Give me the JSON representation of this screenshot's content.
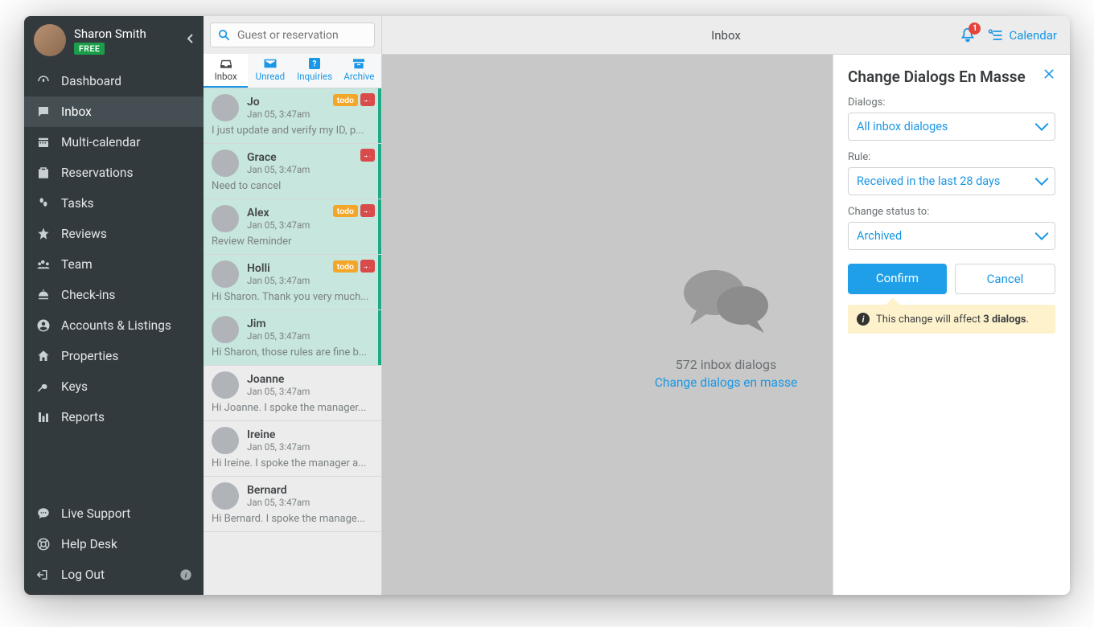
{
  "user": {
    "name": "Sharon Smith",
    "plan": "FREE"
  },
  "nav": {
    "items": [
      {
        "id": "dashboard",
        "label": "Dashboard"
      },
      {
        "id": "inbox",
        "label": "Inbox"
      },
      {
        "id": "multi-calendar",
        "label": "Multi-calendar"
      },
      {
        "id": "reservations",
        "label": "Reservations"
      },
      {
        "id": "tasks",
        "label": "Tasks"
      },
      {
        "id": "reviews",
        "label": "Reviews"
      },
      {
        "id": "team",
        "label": "Team"
      },
      {
        "id": "check-ins",
        "label": "Check-ins"
      },
      {
        "id": "accounts",
        "label": "Accounts & Listings"
      },
      {
        "id": "properties",
        "label": "Properties"
      },
      {
        "id": "keys",
        "label": "Keys"
      },
      {
        "id": "reports",
        "label": "Reports"
      }
    ],
    "bottom": [
      {
        "id": "live-support",
        "label": "Live Support"
      },
      {
        "id": "help-desk",
        "label": "Help Desk"
      },
      {
        "id": "log-out",
        "label": "Log Out"
      }
    ],
    "active": "inbox"
  },
  "search": {
    "placeholder": "Guest or reservation"
  },
  "tabs": [
    {
      "id": "inbox",
      "label": "Inbox"
    },
    {
      "id": "unread",
      "label": "Unread"
    },
    {
      "id": "inquiries",
      "label": "Inquiries"
    },
    {
      "id": "archive",
      "label": "Archive"
    }
  ],
  "tabs_active": "inbox",
  "messages": [
    {
      "name": "Jo",
      "date": "Jan 05, 3:47am",
      "preview": "I just update and verify my ID, p...",
      "todo": "todo",
      "pin": true,
      "highlight": true
    },
    {
      "name": "Grace",
      "date": "Jan 05, 3:47am",
      "preview": "Need to cancel",
      "todo": "",
      "pin": true,
      "highlight": true
    },
    {
      "name": "Alex",
      "date": "Jan 05, 3:47am",
      "preview": "Review Reminder",
      "todo": "todo",
      "pin": true,
      "highlight": true
    },
    {
      "name": "Holli",
      "date": "Jan 05, 3:47am",
      "preview": "Hi Sharon. Thank you very much...",
      "todo": "todo",
      "pin": true,
      "highlight": true
    },
    {
      "name": "Jim",
      "date": "Jan 05, 3:47am",
      "preview": "Hi Sharon, those rules are fine b...",
      "todo": "",
      "pin": false,
      "highlight": true
    },
    {
      "name": "Joanne",
      "date": "Jan 05, 3:47am",
      "preview": "Hi Joanne. I spoke the manager...",
      "todo": "",
      "pin": false,
      "highlight": false
    },
    {
      "name": "Ireine",
      "date": "Jan 05, 3:47am",
      "preview": "Hi Ireine. I spoke the manager a...",
      "todo": "",
      "pin": false,
      "highlight": false
    },
    {
      "name": "Bernard",
      "date": "Jan 05, 3:47am",
      "preview": "Hi Bernard. I spoke the manage...",
      "todo": "",
      "pin": false,
      "highlight": false
    }
  ],
  "topbar": {
    "title": "Inbox",
    "notif_count": "1",
    "calendar_label": "Calendar"
  },
  "empty": {
    "count_text": "572 inbox dialogs",
    "link_text": "Change dialogs en masse"
  },
  "panel": {
    "title": "Change Dialogs En Masse",
    "dialogs_label": "Dialogs:",
    "dialogs_value": "All inbox dialoges",
    "rule_label": "Rule:",
    "rule_value": "Received in the last 28 days",
    "status_label": "Change status to:",
    "status_value": "Archived",
    "confirm": "Confirm",
    "cancel": "Cancel",
    "notice_prefix": "This change will affect ",
    "notice_bold": "3 dialogs",
    "notice_suffix": "."
  }
}
